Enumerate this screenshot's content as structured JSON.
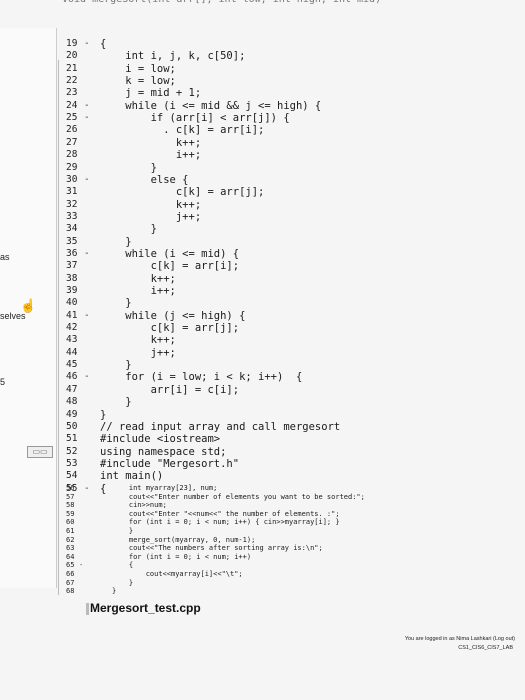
{
  "top_cut_text": "void mergeSort(int arr[], int low, int high, int mid)",
  "side_fragments": [
    "as",
    "selves",
    "5"
  ],
  "file_title": "Mergesort_test.cpp",
  "login": "You are logged in as Nima Lashkari (Log out)",
  "course": "CS1_CIS6_CIS7_LAB",
  "icons": {
    "hand": "hand-pointer-icon",
    "window": "window-icon"
  },
  "code_lines": [
    {
      "num": "19",
      "fold": "-",
      "text": "{"
    },
    {
      "num": "20",
      "fold": "",
      "text": "    int i, j, k, c[50];"
    },
    {
      "num": "21",
      "fold": "",
      "text": "    i = low;"
    },
    {
      "num": "22",
      "fold": "",
      "text": "    k = low;"
    },
    {
      "num": "23",
      "fold": "",
      "text": "    j = mid + 1;"
    },
    {
      "num": "24",
      "fold": "-",
      "text": "    while (i <= mid && j <= high) {"
    },
    {
      "num": "25",
      "fold": "-",
      "text": "        if (arr[i] < arr[j]) {"
    },
    {
      "num": "26",
      "fold": "",
      "text": "          . c[k] = arr[i];"
    },
    {
      "num": "27",
      "fold": "",
      "text": "            k++;"
    },
    {
      "num": "28",
      "fold": "",
      "text": "            i++;"
    },
    {
      "num": "29",
      "fold": "",
      "text": "        }"
    },
    {
      "num": "30",
      "fold": "-",
      "text": "        else {"
    },
    {
      "num": "31",
      "fold": "",
      "text": "            c[k] = arr[j];"
    },
    {
      "num": "32",
      "fold": "",
      "text": "            k++;"
    },
    {
      "num": "33",
      "fold": "",
      "text": "            j++;"
    },
    {
      "num": "34",
      "fold": "",
      "text": "        }"
    },
    {
      "num": "35",
      "fold": "",
      "text": "    }"
    },
    {
      "num": "36",
      "fold": "-",
      "text": "    while (i <= mid) {"
    },
    {
      "num": "37",
      "fold": "",
      "text": "        c[k] = arr[i];"
    },
    {
      "num": "38",
      "fold": "",
      "text": "        k++;"
    },
    {
      "num": "39",
      "fold": "",
      "text": "        i++;"
    },
    {
      "num": "40",
      "fold": "",
      "text": "    }"
    },
    {
      "num": "41",
      "fold": "-",
      "text": "    while (j <= high) {"
    },
    {
      "num": "42",
      "fold": "",
      "text": "        c[k] = arr[j];"
    },
    {
      "num": "43",
      "fold": "",
      "text": "        k++;"
    },
    {
      "num": "44",
      "fold": "",
      "text": "        j++;"
    },
    {
      "num": "45",
      "fold": "",
      "text": "    }"
    },
    {
      "num": "46",
      "fold": "-",
      "text": "    for (i = low; i < k; i++)  {"
    },
    {
      "num": "47",
      "fold": "",
      "text": "        arr[i] = c[i];"
    },
    {
      "num": "48",
      "fold": "",
      "text": "    }"
    },
    {
      "num": "49",
      "fold": "",
      "text": "}"
    },
    {
      "num": "50",
      "fold": "",
      "text": "// read input array and call mergesort"
    },
    {
      "num": "51",
      "fold": "",
      "text": "#include <iostream>"
    },
    {
      "num": "52",
      "fold": "",
      "text": "using namespace std;"
    },
    {
      "num": "53",
      "fold": "",
      "text": "#include \"Mergesort.h\""
    },
    {
      "num": "54",
      "fold": "",
      "text": "int main()"
    },
    {
      "num": "55",
      "fold": "-",
      "text": "{"
    },
    {
      "num": "56",
      "fold": "",
      "text": "    int myarray[23], num;"
    },
    {
      "num": "57",
      "fold": "",
      "text": "    cout<<\"Enter number of elements you want to be sorted:\";"
    },
    {
      "num": "58",
      "fold": "",
      "text": "    cin>>num;"
    },
    {
      "num": "59",
      "fold": "",
      "text": "    cout<<\"Enter \"<<num<<\" the number of elements. :\";"
    },
    {
      "num": "60",
      "fold": "",
      "text": "    for (int i = 0; i < num; i++) { cin>>myarray[i]; }"
    },
    {
      "num": "61",
      "fold": "",
      "text": "    }"
    },
    {
      "num": "62",
      "fold": "",
      "text": "    merge_sort(myarray, 0, num-1);"
    },
    {
      "num": "63",
      "fold": "",
      "text": "    cout<<\"The numbers after sorting array is:\\n\";"
    },
    {
      "num": "64",
      "fold": "",
      "text": "    for (int i = 0; i < num; i++)"
    },
    {
      "num": "65",
      "fold": "-",
      "text": "    {"
    },
    {
      "num": "66",
      "fold": "",
      "text": "        cout<<myarray[i]<<\"\\t\";"
    },
    {
      "num": "67",
      "fold": "",
      "text": "    }"
    },
    {
      "num": "68",
      "fold": "",
      "text": "}"
    }
  ]
}
